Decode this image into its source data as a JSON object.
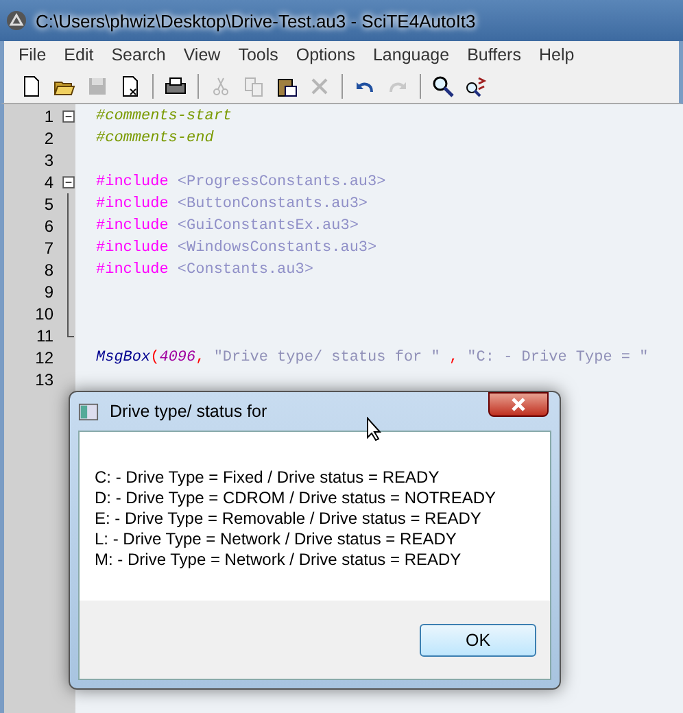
{
  "window": {
    "title": "C:\\Users\\phwiz\\Desktop\\Drive-Test.au3 - SciTE4AutoIt3"
  },
  "menu": [
    "File",
    "Edit",
    "Search",
    "View",
    "Tools",
    "Options",
    "Language",
    "Buffers",
    "Help"
  ],
  "toolbar": [
    {
      "kind": "new",
      "disabled": false
    },
    {
      "kind": "open",
      "disabled": false
    },
    {
      "kind": "save",
      "disabled": true
    },
    {
      "kind": "close",
      "disabled": false
    },
    {
      "kind": "sep"
    },
    {
      "kind": "print",
      "disabled": false
    },
    {
      "kind": "sep"
    },
    {
      "kind": "cut",
      "disabled": true
    },
    {
      "kind": "copy",
      "disabled": true
    },
    {
      "kind": "paste",
      "disabled": false
    },
    {
      "kind": "delete",
      "disabled": true
    },
    {
      "kind": "sep"
    },
    {
      "kind": "undo",
      "disabled": false
    },
    {
      "kind": "redo",
      "disabled": true
    },
    {
      "kind": "sep"
    },
    {
      "kind": "find",
      "disabled": false
    },
    {
      "kind": "replace",
      "disabled": false
    }
  ],
  "editor": {
    "lines": [
      {
        "number": "1",
        "kind": "foldstart",
        "tokens": [
          {
            "kind": "comment",
            "text": "#comments-start"
          }
        ]
      },
      {
        "number": "2",
        "kind": "plain",
        "tokens": [
          {
            "kind": "comment",
            "text": "#comments-end"
          }
        ]
      },
      {
        "number": "3",
        "kind": "plain"
      },
      {
        "number": "4",
        "kind": "foldstart",
        "tokens": [
          {
            "kind": "directive",
            "text": "#include"
          },
          {
            "kind": "path",
            "text": " <ProgressConstants.au3>"
          }
        ]
      },
      {
        "number": "5",
        "kind": "foldbody",
        "tokens": [
          {
            "kind": "directive",
            "text": "#include"
          },
          {
            "kind": "path",
            "text": " <ButtonConstants.au3>"
          }
        ]
      },
      {
        "number": "6",
        "kind": "foldbody",
        "tokens": [
          {
            "kind": "directive",
            "text": "#include"
          },
          {
            "kind": "path",
            "text": " <GuiConstantsEx.au3>"
          }
        ]
      },
      {
        "number": "7",
        "kind": "foldbody",
        "tokens": [
          {
            "kind": "directive",
            "text": "#include"
          },
          {
            "kind": "path",
            "text": " <WindowsConstants.au3>"
          }
        ]
      },
      {
        "number": "8",
        "kind": "foldbody",
        "tokens": [
          {
            "kind": "directive",
            "text": "#include"
          },
          {
            "kind": "path",
            "text": " <Constants.au3>"
          }
        ]
      },
      {
        "number": "9",
        "kind": "foldbody"
      },
      {
        "number": "10",
        "kind": "foldbody"
      },
      {
        "number": "11",
        "kind": "foldend"
      },
      {
        "number": "12",
        "kind": "plain",
        "tokens": [
          {
            "kind": "function",
            "text": "MsgBox"
          },
          {
            "kind": "operator",
            "text": "("
          },
          {
            "kind": "number",
            "text": "4096"
          },
          {
            "kind": "operator",
            "text": ","
          },
          {
            "kind": "string",
            "text": " \"Drive type/ status for \" "
          },
          {
            "kind": "operator",
            "text": ","
          },
          {
            "kind": "string",
            "text": " \"C: - Drive Type = \""
          }
        ]
      },
      {
        "number": "13",
        "kind": "plain"
      }
    ]
  },
  "dialog": {
    "title": "Drive type/ status for",
    "lines": [
      "C: - Drive Type = Fixed / Drive status = READY",
      "D: - Drive Type = CDROM / Drive status = NOTREADY",
      "E: - Drive Type = Removable / Drive status = READY",
      "L: - Drive Type = Network / Drive status = READY",
      "M: - Drive Type = Network / Drive status = READY"
    ],
    "button": "OK"
  }
}
